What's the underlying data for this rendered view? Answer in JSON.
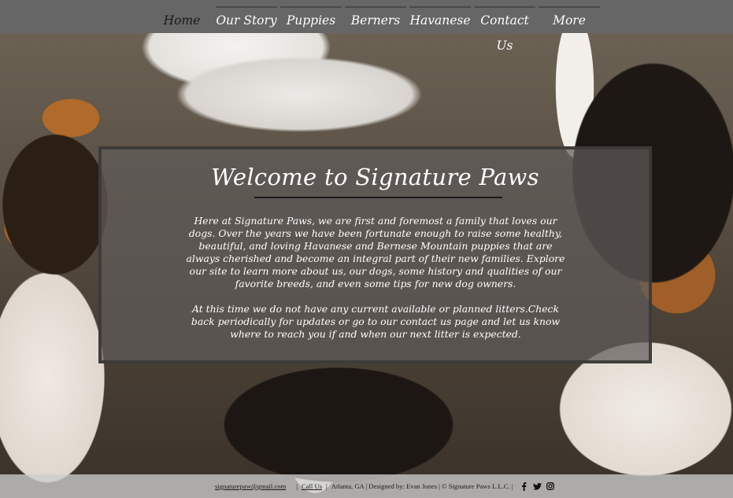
{
  "nav": {
    "items": [
      {
        "label": "Home",
        "active": true
      },
      {
        "label": "Our Story",
        "active": false
      },
      {
        "label": "Puppies",
        "active": false
      },
      {
        "label": "Berners",
        "active": false
      },
      {
        "label": "Havanese",
        "active": false
      },
      {
        "label": "Contact Us",
        "active": false
      },
      {
        "label": "More",
        "active": false
      }
    ]
  },
  "welcome": {
    "title": "Welcome to Signature Paws",
    "intro": "Here at Signature Paws, we are first and foremost a family that loves our dogs. Over the years we have been fortunate enough to raise some healthy, beautiful, and loving Havanese and Bernese Mountain puppies that are always cherished and become an integral part of their new families. Explore our site to learn more about us, our dogs, some history and qualities of our favorite breeds, and even some tips for new dog owners.",
    "notice": "At this time we do not have any current available or planned litters.Check back periodically for updates or go to our contact us page and let us know where to reach you if and when our next litter is expected."
  },
  "footer": {
    "email": "signaturepaw@gmail.com",
    "call_us": "Call Us",
    "sep1": "|",
    "sep2": "|",
    "info": "Atlanta, GA | Designed by: Evan Jones | © Signature Paws L.L.C. |",
    "social": [
      "facebook-icon",
      "twitter-icon",
      "instagram-icon"
    ]
  },
  "colors": {
    "topbar": "#666666",
    "panel": "#5f5c5a",
    "text": "#ffffff",
    "active_nav": "#1a1a1a"
  }
}
